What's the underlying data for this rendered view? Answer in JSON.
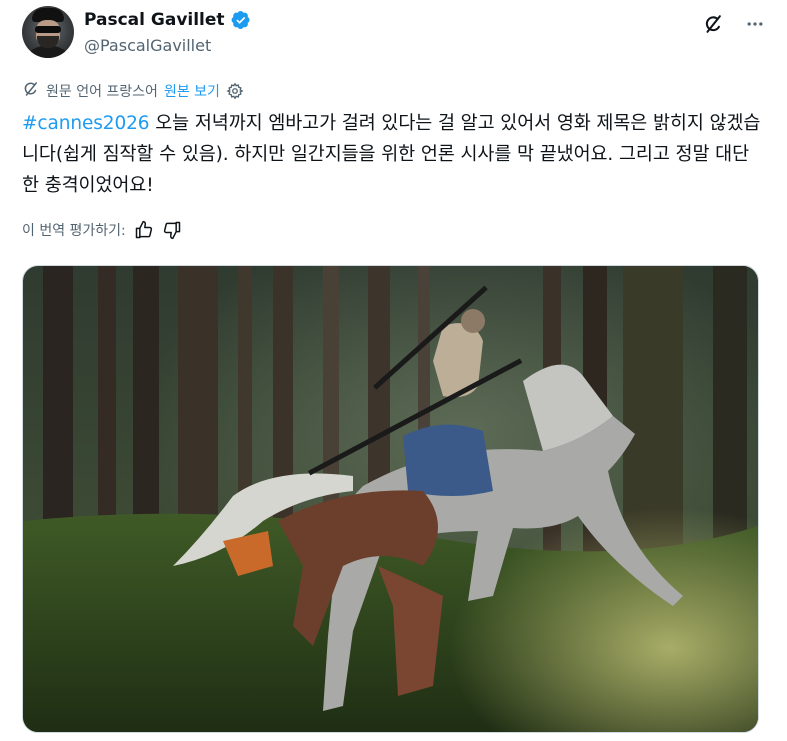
{
  "author": {
    "display_name": "Pascal Gavillet",
    "handle": "@PascalGavillet",
    "verified": true
  },
  "translation": {
    "source_label": "원문 언어 프랑스어",
    "show_original_label": "원본 보기"
  },
  "tweet": {
    "hashtag": "#cannes2026",
    "body": " 오늘 저녁까지 엠바고가 걸려 있다는 걸 알고 있어서 영화 제목은 밝히지 않겠습니다(쉽게 짐작할 수 있음). 하지만 일간지들을 위한 언론 시사를 막 끝냈어요. 그리고 정말 대단한 충격이었어요!"
  },
  "rating": {
    "label": "이 번역 평가하기:"
  },
  "icons": {
    "grok": "grok-icon",
    "more": "more-icon",
    "translate": "translate-icon",
    "settings": "gear-icon",
    "thumbs_up": "thumbs-up-icon",
    "thumbs_down": "thumbs-down-icon",
    "verified": "verified-badge-icon"
  },
  "colors": {
    "accent": "#1d9bf0",
    "secondary_text": "#536471",
    "primary_text": "#0f1419"
  }
}
